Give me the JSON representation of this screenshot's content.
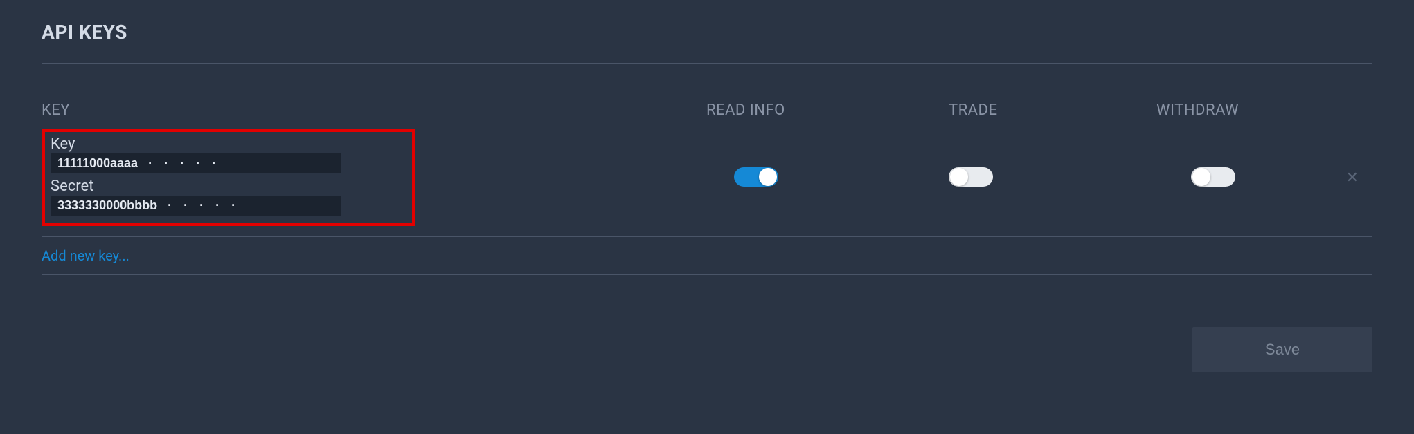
{
  "title": "API KEYS",
  "columns": {
    "key": "KEY",
    "read_info": "READ INFO",
    "trade": "TRADE",
    "withdraw": "WITHDRAW"
  },
  "api_key_row": {
    "key_label": "Key",
    "key_value_prefix": "11111000aaaa",
    "key_value_dots": " · · · · ·",
    "secret_label": "Secret",
    "secret_value_prefix": "3333330000bbbb",
    "secret_value_dots": " · · · · ·",
    "read_info_enabled": true,
    "trade_enabled": false,
    "withdraw_enabled": false
  },
  "add_new_key_label": "Add new key...",
  "save_button_label": "Save"
}
